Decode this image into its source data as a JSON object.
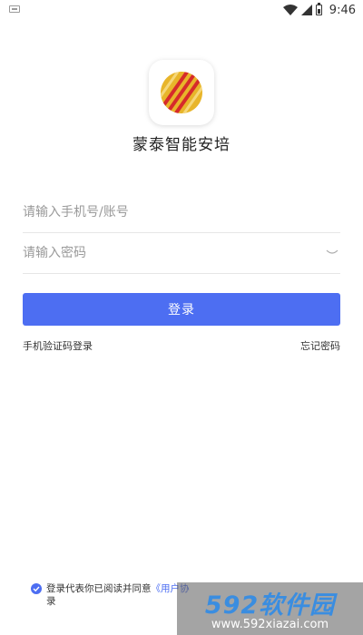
{
  "status_bar": {
    "time": "9:46",
    "icons": [
      "notification-icon",
      "wifi-icon",
      "signal-icon",
      "battery-icon"
    ]
  },
  "app": {
    "name": "蒙泰智能安培",
    "logo_icon": "striped-ball-logo",
    "logo_colors": [
      "#e8b52a",
      "#d62b2b"
    ]
  },
  "form": {
    "account_placeholder": "请输入手机号/账号",
    "password_placeholder": "请输入密码",
    "login_label": "登录",
    "sms_login_label": "手机验证码登录",
    "forgot_password_label": "忘记密码"
  },
  "agreement": {
    "checked": true,
    "text_prefix": "登录代表你已阅读并同意",
    "link_text": "《用户协",
    "text_suffix": "录"
  },
  "watermark": {
    "logo": "592软件园",
    "url": "www.592xiazai.com"
  },
  "colors": {
    "accent": "#4d6ef2",
    "background": "#ffffff",
    "placeholder": "#9a9a9a"
  }
}
